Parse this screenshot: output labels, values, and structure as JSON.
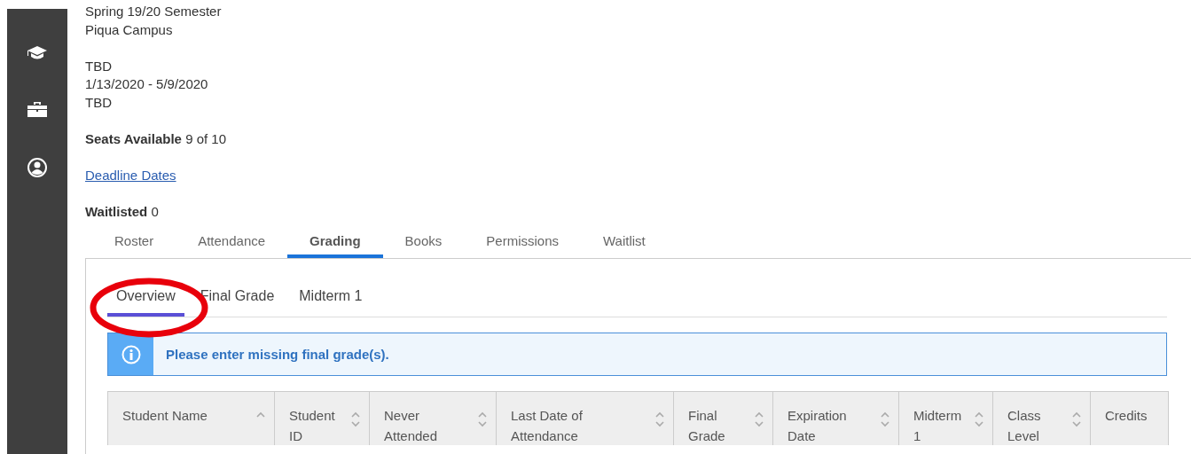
{
  "sidebar": {
    "items": [
      {
        "kind": "graduation"
      },
      {
        "kind": "toolbox"
      },
      {
        "kind": "user"
      }
    ]
  },
  "section_info": {
    "term_lines": [
      "Spring 19/20 Semester",
      "Piqua Campus"
    ],
    "schedule_lines": [
      "TBD",
      "1/13/2020 - 5/9/2020",
      "TBD"
    ],
    "seats": {
      "label": "Seats Available",
      "value": "9 of 10"
    },
    "deadline_link": "Deadline Dates",
    "waitlisted": {
      "label": "Waitlisted",
      "value": "0"
    }
  },
  "tabs": [
    {
      "label": "Roster",
      "selected": false
    },
    {
      "label": "Attendance",
      "selected": false
    },
    {
      "label": "Grading",
      "selected": true
    },
    {
      "label": "Books",
      "selected": false
    },
    {
      "label": "Permissions",
      "selected": false
    },
    {
      "label": "Waitlist",
      "selected": false
    }
  ],
  "subtabs": [
    {
      "label": "Overview",
      "selected": true
    },
    {
      "label": "Final Grade",
      "selected": false
    },
    {
      "label": "Midterm 1",
      "selected": false
    }
  ],
  "alert": {
    "message": "Please enter missing final grade(s)."
  },
  "table": {
    "columns": [
      {
        "label": "Student Name",
        "kind": "sort-up"
      },
      {
        "label": "Student ID",
        "kind": "sortable"
      },
      {
        "label": "Never Attended",
        "kind": "sortable"
      },
      {
        "label": "Last Date of Attendance",
        "kind": "sortable"
      },
      {
        "label": "Final Grade",
        "kind": "sortable"
      },
      {
        "label": "Expiration Date",
        "kind": "sortable"
      },
      {
        "label": "Midterm 1",
        "kind": "sortable"
      },
      {
        "label": "Class Level",
        "kind": "sortable"
      },
      {
        "label": "Credits",
        "kind": "plain"
      }
    ]
  }
}
